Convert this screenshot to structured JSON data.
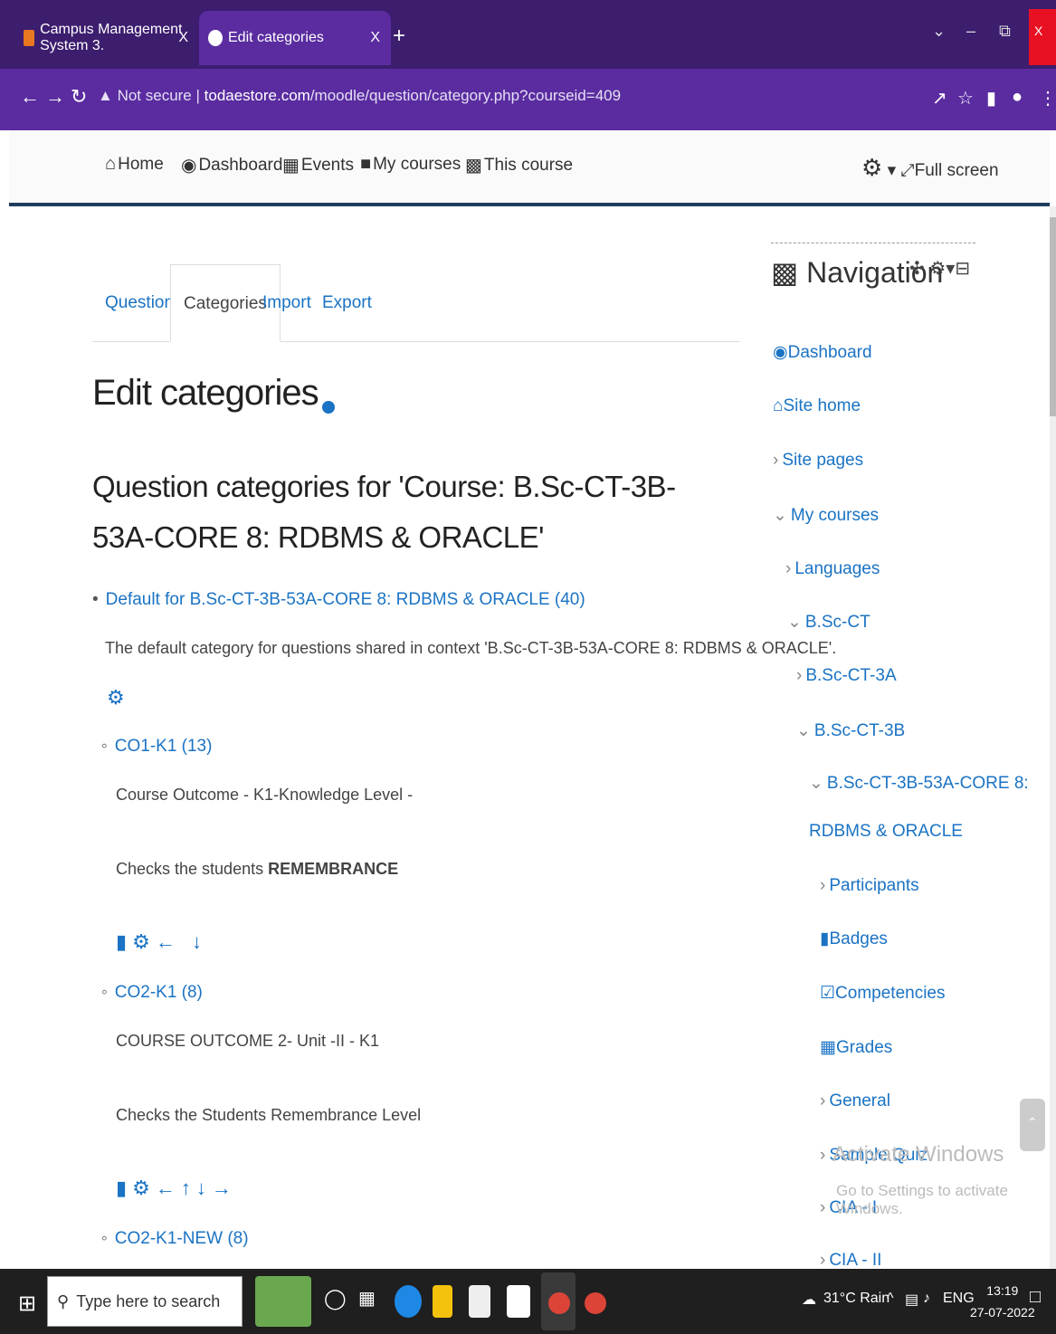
{
  "browser": {
    "tabs": [
      {
        "title": "Campus Management System 3.",
        "close": "X"
      },
      {
        "title": "Edit categories",
        "close": "X"
      }
    ],
    "new_tab": "+",
    "window_close": "Close",
    "security": "Not secure",
    "url_domain": "todaestore.com",
    "url_path": "/moodle/question/category.php?courseid=409"
  },
  "topnav": {
    "items": [
      "Home",
      "Dashboard",
      "Events",
      "My courses",
      "This course"
    ],
    "fullscreen": "Full screen"
  },
  "qtabs": [
    "Questions",
    "Categories",
    "Import",
    "Export"
  ],
  "page": {
    "title": "Edit categories",
    "subtitle": "Question categories for 'Course: B.Sc-CT-3B-53A-CORE 8: RDBMS & ORACLE'"
  },
  "categories": {
    "default": {
      "link": "Default for B.Sc-CT-3B-53A-CORE 8: RDBMS & ORACLE (40)",
      "desc": "The default category for questions shared in context 'B.Sc-CT-3B-53A-CORE 8: RDBMS & ORACLE'."
    },
    "c1": {
      "link": "CO1-K1 (13)",
      "line1": "Course Outcome - K1-Knowledge Level -",
      "line2_prefix": "Checks the students ",
      "line2_bold": "REMEMBRANCE"
    },
    "c2": {
      "link": "CO2-K1 (8)",
      "line1": "COURSE OUTCOME 2- Unit -II - K1",
      "line2": "Checks the Students Remembrance Level"
    },
    "c3": {
      "link": "CO2-K1-NEW (8)"
    }
  },
  "navigation": {
    "title": "Navigation",
    "items": [
      "Dashboard",
      "Site home",
      "Site pages",
      "My courses",
      "Languages",
      "B.Sc-CT",
      "B.Sc-CT-3A",
      "B.Sc-CT-3B",
      "B.Sc-CT-3B-53A-CORE 8:",
      "RDBMS & ORACLE",
      "Participants",
      "Badges",
      "Competencies",
      "Grades",
      "General",
      "Sample Quiz",
      "CIA - I",
      "CIA - II"
    ]
  },
  "watermark": {
    "title": "Activate Windows",
    "sub": "Go to Settings to activate Windows."
  },
  "taskbar": {
    "search_placeholder": "Type here to search",
    "weather": "31°C Rain",
    "lang": "ENG",
    "time": "13:19",
    "date": "27-07-2022"
  }
}
